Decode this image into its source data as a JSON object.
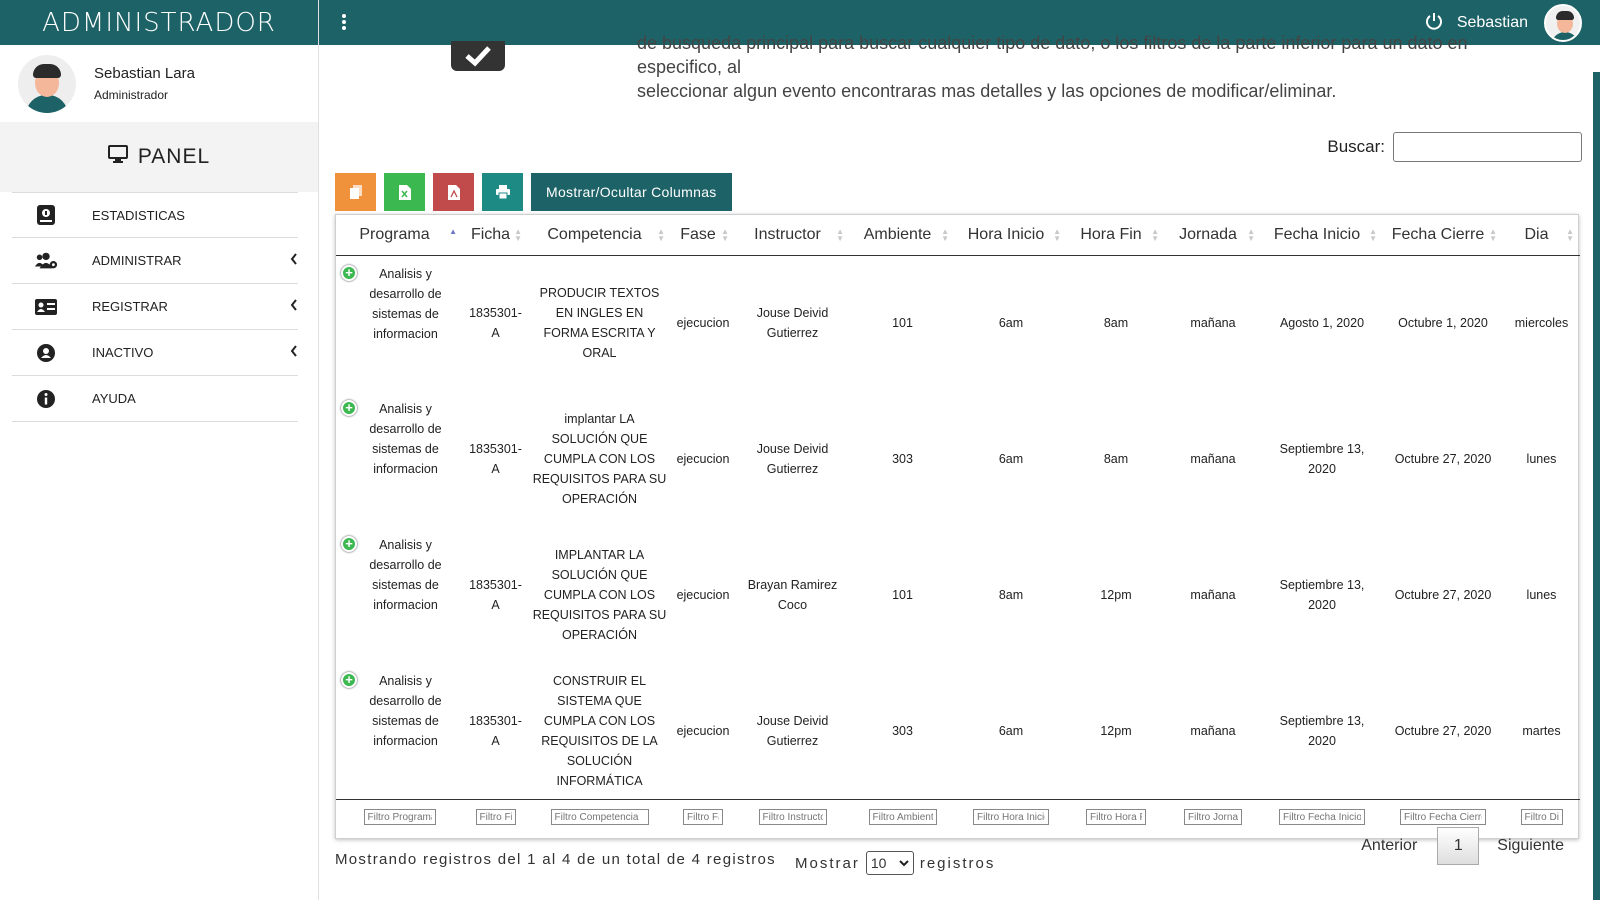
{
  "app": {
    "brand": "ADMINISTRADOR"
  },
  "sidebar": {
    "user_name": "Sebastian Lara",
    "user_role": "Administrador",
    "panel_label": "PANEL",
    "items": [
      {
        "label": "ESTADISTICAS",
        "icon": "chart-book-icon",
        "has_arrow": false
      },
      {
        "label": "ADMINISTRAR",
        "icon": "users-gear-icon",
        "has_arrow": true
      },
      {
        "label": "REGISTRAR",
        "icon": "id-card-icon",
        "has_arrow": true
      },
      {
        "label": "INACTIVO",
        "icon": "circle-user-icon",
        "has_arrow": true
      },
      {
        "label": "AYUDA",
        "icon": "info-icon",
        "has_arrow": false
      }
    ]
  },
  "topbar": {
    "user_name": "Sebastian"
  },
  "main": {
    "intro_line1": "de busqueda principal para buscar cualquier tipo de dato, o los filtros de la parte inferior para un dato en especifico, al",
    "intro_line2": "seleccionar algun evento encontraras mas detalles y las opciones de modificar/eliminar.",
    "search_label": "Buscar:",
    "search_value": "",
    "toggle_columns_label": "Mostrar/Ocultar Columnas"
  },
  "table": {
    "headers": [
      "Programa",
      "Ficha",
      "Competencia",
      "Fase",
      "Instructor",
      "Ambiente",
      "Hora Inicio",
      "Hora Fin",
      "Jornada",
      "Fecha Inicio",
      "Fecha Cierre",
      "Dia"
    ],
    "rows": [
      [
        "Analisis y desarrollo de sistemas de informacion",
        "1835301-A",
        "PRODUCIR TEXTOS EN INGLES EN FORMA ESCRITA Y ORAL",
        "ejecucion",
        "Jouse Deivid Gutierrez",
        "101",
        "6am",
        "8am",
        "mañana",
        "Agosto 1, 2020",
        "Octubre 1, 2020",
        "miercoles"
      ],
      [
        "Analisis y desarrollo de sistemas de informacion",
        "1835301-A",
        "implantar LA SOLUCIÓN QUE CUMPLA CON LOS REQUISITOS PARA SU OPERACIÓN",
        "ejecucion",
        "Jouse Deivid Gutierrez",
        "303",
        "6am",
        "8am",
        "mañana",
        "Septiembre 13, 2020",
        "Octubre 27, 2020",
        "lunes"
      ],
      [
        "Analisis y desarrollo de sistemas de informacion",
        "1835301-A",
        "IMPLANTAR LA SOLUCIÓN QUE CUMPLA CON LOS REQUISITOS PARA SU OPERACIÓN",
        "ejecucion",
        "Brayan Ramirez Coco",
        "101",
        "8am",
        "12pm",
        "mañana",
        "Septiembre 13, 2020",
        "Octubre 27, 2020",
        "lunes"
      ],
      [
        "Analisis y desarrollo de sistemas de informacion",
        "1835301-A",
        "CONSTRUIR EL SISTEMA QUE CUMPLA CON LOS REQUISITOS DE LA SOLUCIÓN INFORMÁTICA",
        "ejecucion",
        "Jouse Deivid Gutierrez",
        "303",
        "6am",
        "12pm",
        "mañana",
        "Septiembre 13, 2020",
        "Octubre 27, 2020",
        "martes"
      ]
    ],
    "filters": [
      "Filtro Programa",
      "Filtro Ficha",
      "Filtro Competencia",
      "Filtro Fase",
      "Filtro Instructor",
      "Filtro Ambiente",
      "Filtro Hora Inicio",
      "Filtro Hora Fin",
      "Filtro Jornada",
      "Filtro Fecha Inicio",
      "Filtro Fecha Cierre",
      "Filtro Dia"
    ],
    "sorted_column": "Programa"
  },
  "footer": {
    "info": "Mostrando registros del 1 al 4 de un total de 4 registros",
    "show_label": "Mostrar",
    "page_size": "10",
    "records_label": "registros",
    "prev_label": "Anterior",
    "current_page": "1",
    "next_label": "Siguiente"
  },
  "colors": {
    "primary": "#1d6266",
    "copy": "#f0923c",
    "excel": "#3cb851",
    "pdf": "#c14a4a",
    "print": "#1d8a84",
    "sort_active": "#6a74c4"
  }
}
